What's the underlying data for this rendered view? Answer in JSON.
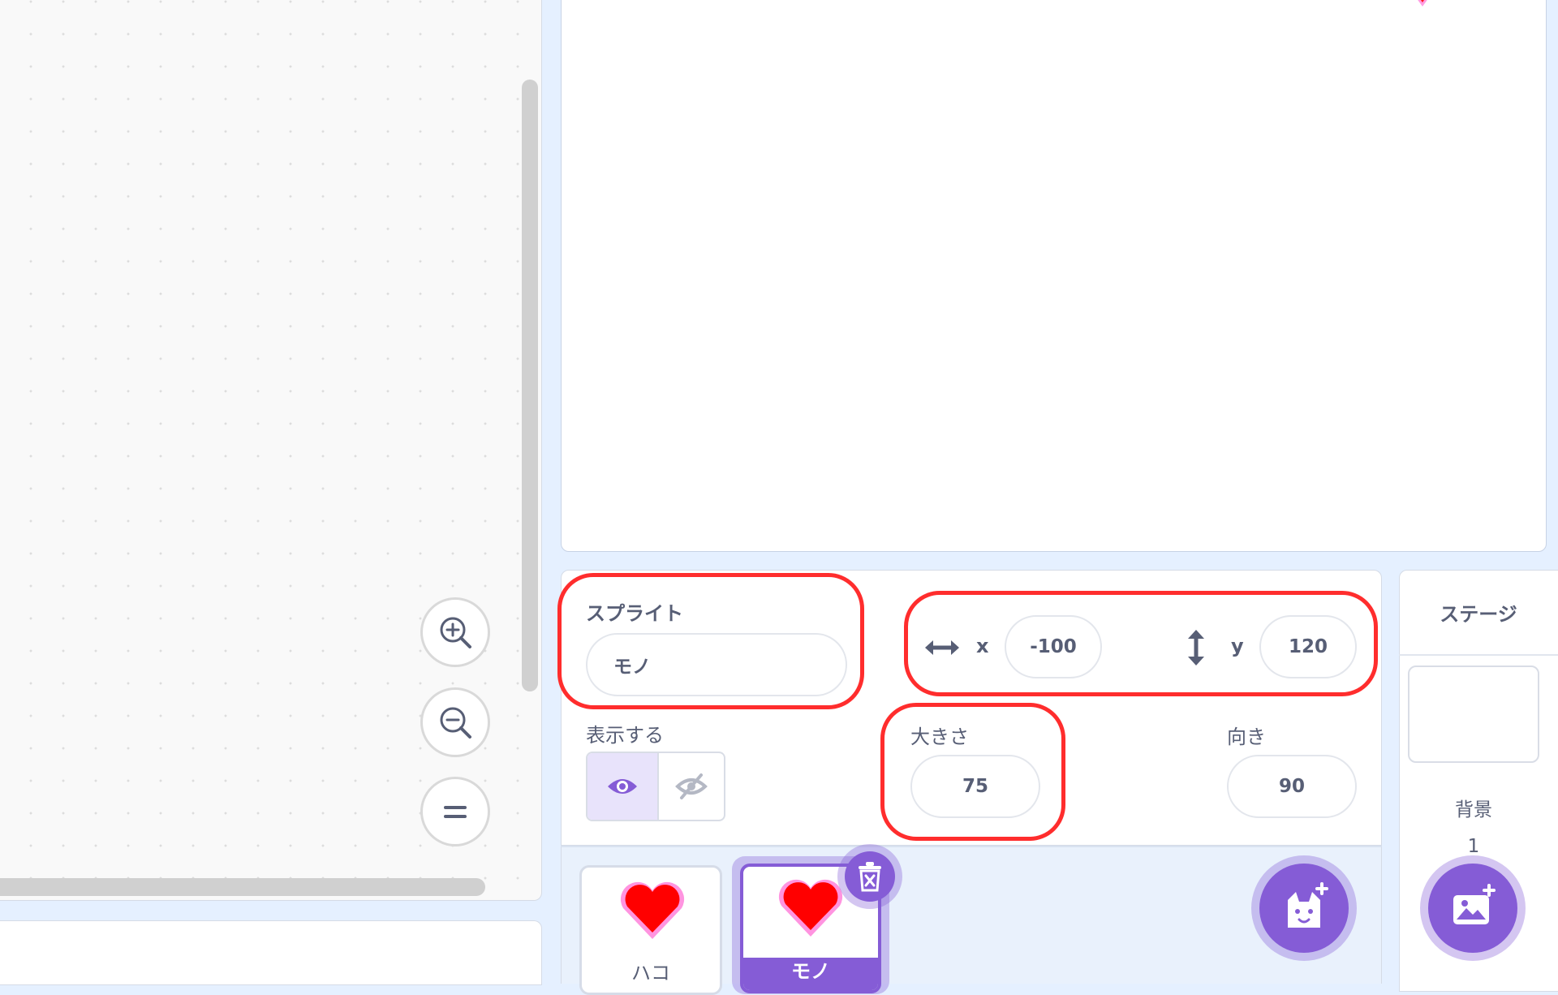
{
  "sprite_info": {
    "sprite_label": "スプライト",
    "sprite_name": "モノ",
    "x_label": "x",
    "x_value": "-100",
    "y_label": "y",
    "y_value": "120",
    "show_label": "表示する",
    "size_label": "大きさ",
    "size_value": "75",
    "direction_label": "向き",
    "direction_value": "90"
  },
  "sprites": [
    {
      "name": "ハコ",
      "selected": false
    },
    {
      "name": "モノ",
      "selected": true
    }
  ],
  "stage_panel": {
    "title": "ステージ",
    "backdrop_label": "背景",
    "backdrop_count": "1"
  },
  "icons": {
    "zoom_in": "zoom-in-icon",
    "zoom_out": "zoom-out-icon",
    "zoom_reset": "equals-icon",
    "show": "eye-icon",
    "hide": "eye-slash-icon",
    "delete": "trash-icon",
    "add_sprite": "cat-plus-icon",
    "add_backdrop": "image-plus-icon"
  },
  "colors": {
    "accent": "#855cd6",
    "highlight": "#ff2d2d",
    "heart": "#ff0000"
  }
}
